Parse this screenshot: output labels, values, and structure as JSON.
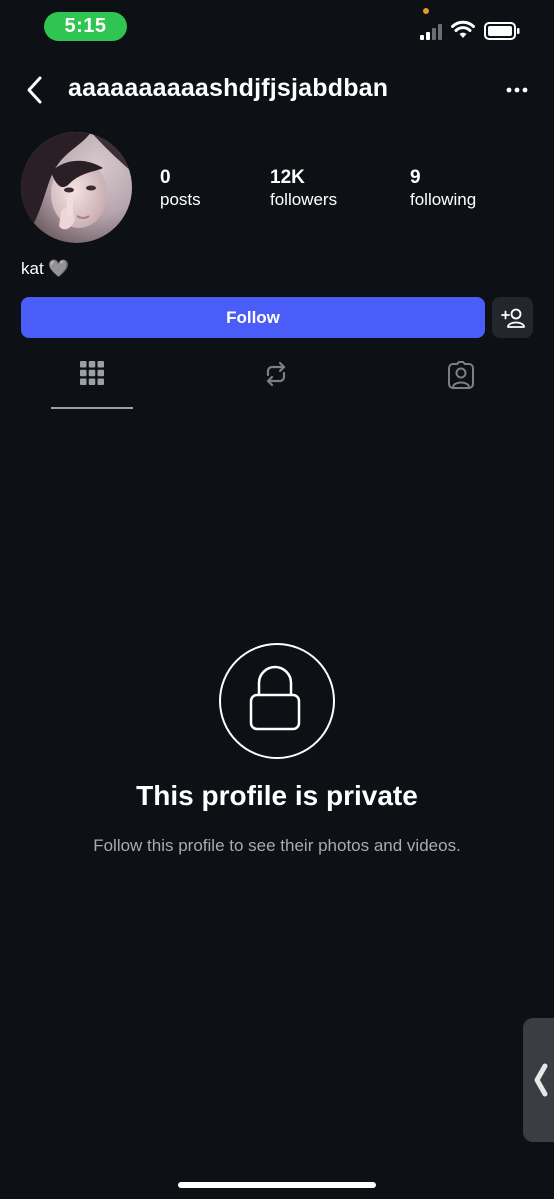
{
  "status_bar": {
    "time": "5:15"
  },
  "header": {
    "username": "aaaaaaaaaashdjfjsjabdban"
  },
  "profile": {
    "stats": [
      {
        "number": "0",
        "label": "posts"
      },
      {
        "number": "12K",
        "label": "followers"
      },
      {
        "number": "9",
        "label": "following"
      }
    ],
    "bio": "kat 🩶"
  },
  "actions": {
    "follow_label": "Follow"
  },
  "tabs": [
    "grid-icon",
    "repost-icon",
    "tagged-icon"
  ],
  "private": {
    "title": "This profile is private",
    "subtitle": "Follow this profile to see their photos and videos."
  },
  "colors": {
    "background": "#0d1014",
    "accent": "#4a5df9",
    "status_pill": "#30c552"
  }
}
